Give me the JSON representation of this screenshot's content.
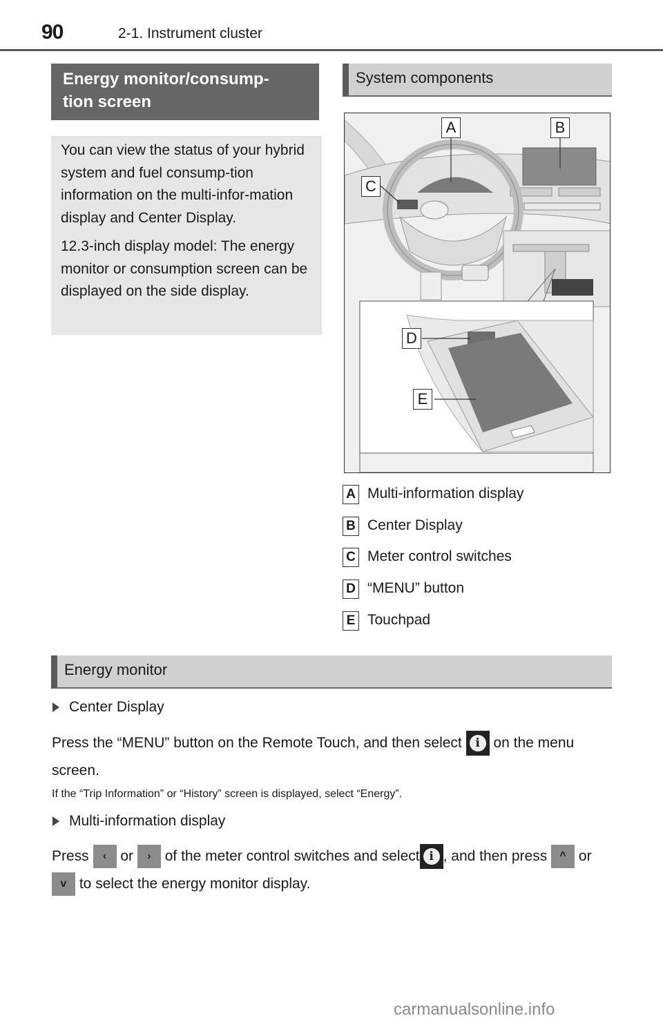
{
  "header": {
    "page_number": "90",
    "chapter": "2-1. Instrument cluster"
  },
  "left": {
    "heading": "Energy monitor/consump-tion screen",
    "heading_line1": "Energy monitor/consump-",
    "heading_line2": "tion screen",
    "intro_p1": "You can view the status of your hybrid system and fuel consump-tion information on the multi-infor-mation display and Center Display.",
    "intro_p2": "12.3-inch display model: The energy monitor or consumption screen can be displayed on the side display."
  },
  "system_components": {
    "heading": "System components",
    "callouts": [
      "A",
      "B",
      "C",
      "D",
      "E"
    ],
    "items": [
      {
        "key": "A",
        "label": "Multi-information display"
      },
      {
        "key": "B",
        "label": "Center Display"
      },
      {
        "key": "C",
        "label": "Meter control switches"
      },
      {
        "key": "D",
        "label": "“MENU” button"
      },
      {
        "key": "E",
        "label": "Touchpad"
      }
    ]
  },
  "energy_monitor": {
    "heading": "Energy monitor",
    "center_display": {
      "bullet": "Center Display",
      "text_before_icon": "Press the “MENU” button on the Remote Touch, and then select",
      "text_after_icon": "on the menu screen.",
      "note": "If the “Trip Information” or “History” screen is displayed, select “Energy”."
    },
    "mid": {
      "bullet": "Multi-information display",
      "t1": "Press",
      "t2": "or",
      "t3": "of the meter control switches and select",
      "t4": ", and then press",
      "t5": "or",
      "t6": "to select the energy monitor display."
    },
    "icons": {
      "left": "‹",
      "right": "›",
      "up": "^",
      "down": "v",
      "info": "i"
    }
  },
  "watermark": "carmanualsonline.info"
}
